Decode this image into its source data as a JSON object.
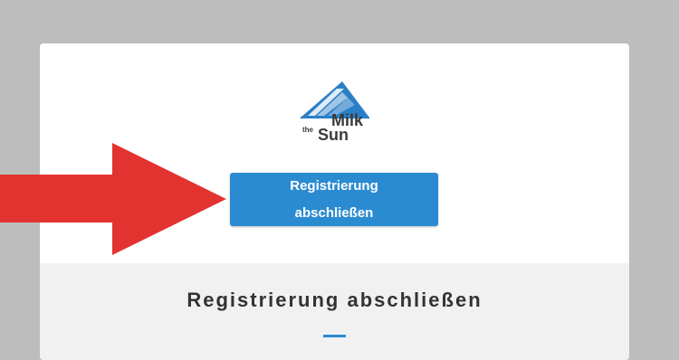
{
  "colors": {
    "page_background": "#bdbdbd",
    "card_background": "#ffffff",
    "lower_section_background": "#f1f1f1",
    "accent": "#2b8bd1",
    "logo_blue": "#2a7fc6",
    "arrow_red": "#e23330",
    "text_dark": "#333333"
  },
  "logo": {
    "word_the": "the",
    "word_milk": "Milk",
    "word_sun": "Sun",
    "icon": "mountain-solar-panel-icon"
  },
  "cta": {
    "line1": "Registrierung",
    "line2": "abschließen"
  },
  "section": {
    "title": "Registrierung abschließen"
  },
  "annotation": {
    "icon": "red-arrow-right-icon"
  }
}
